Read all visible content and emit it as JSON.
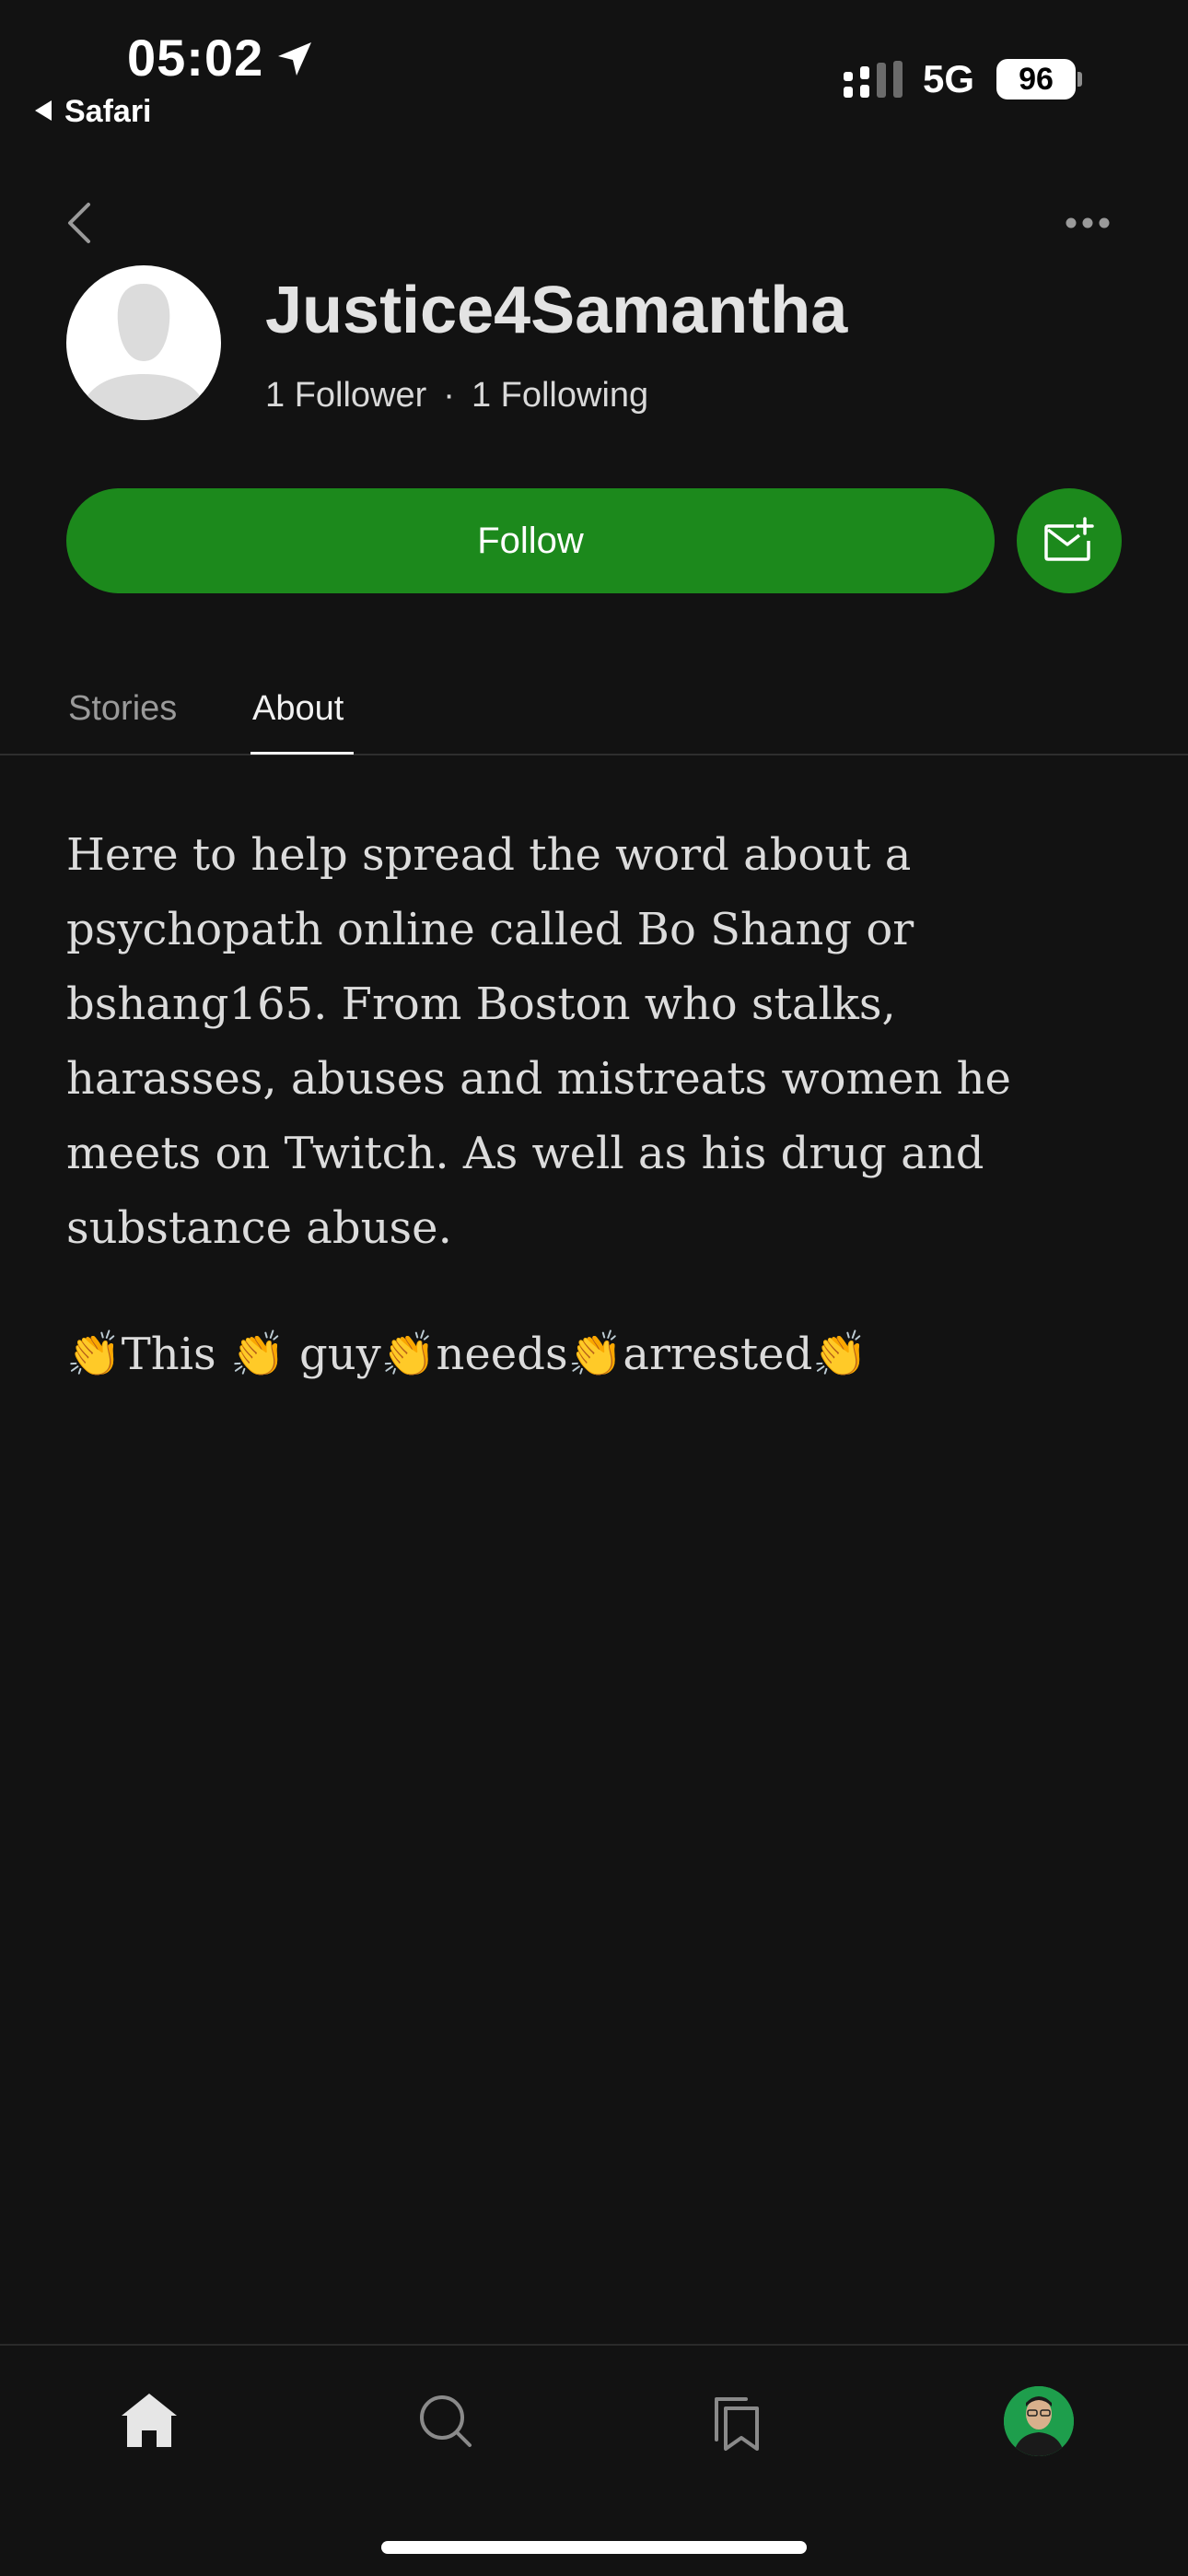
{
  "status_bar": {
    "time": "05:02",
    "back_app": "Safari",
    "network": "5G",
    "battery": "96"
  },
  "profile": {
    "username": "Justice4Samantha",
    "followers": "1 Follower",
    "separator": "·",
    "following": "1 Following"
  },
  "actions": {
    "follow_label": "Follow"
  },
  "tabs": [
    {
      "label": "Stories",
      "active": false
    },
    {
      "label": "About",
      "active": true
    }
  ],
  "about": {
    "bio": "Here to help spread the word about a psychopath online called Bo Shang or bshang165. From Boston who stalks, harasses, abuses and mistreats women he meets on Twitch. As well as his drug and substance abuse.",
    "tagline": "👏This 👏 guy👏needs👏arrested👏"
  },
  "bottom_nav": [
    {
      "icon": "home-icon"
    },
    {
      "icon": "search-icon"
    },
    {
      "icon": "bookmarks-icon"
    },
    {
      "icon": "profile-avatar"
    }
  ],
  "colors": {
    "background": "#121212",
    "accent": "#1c891c"
  }
}
